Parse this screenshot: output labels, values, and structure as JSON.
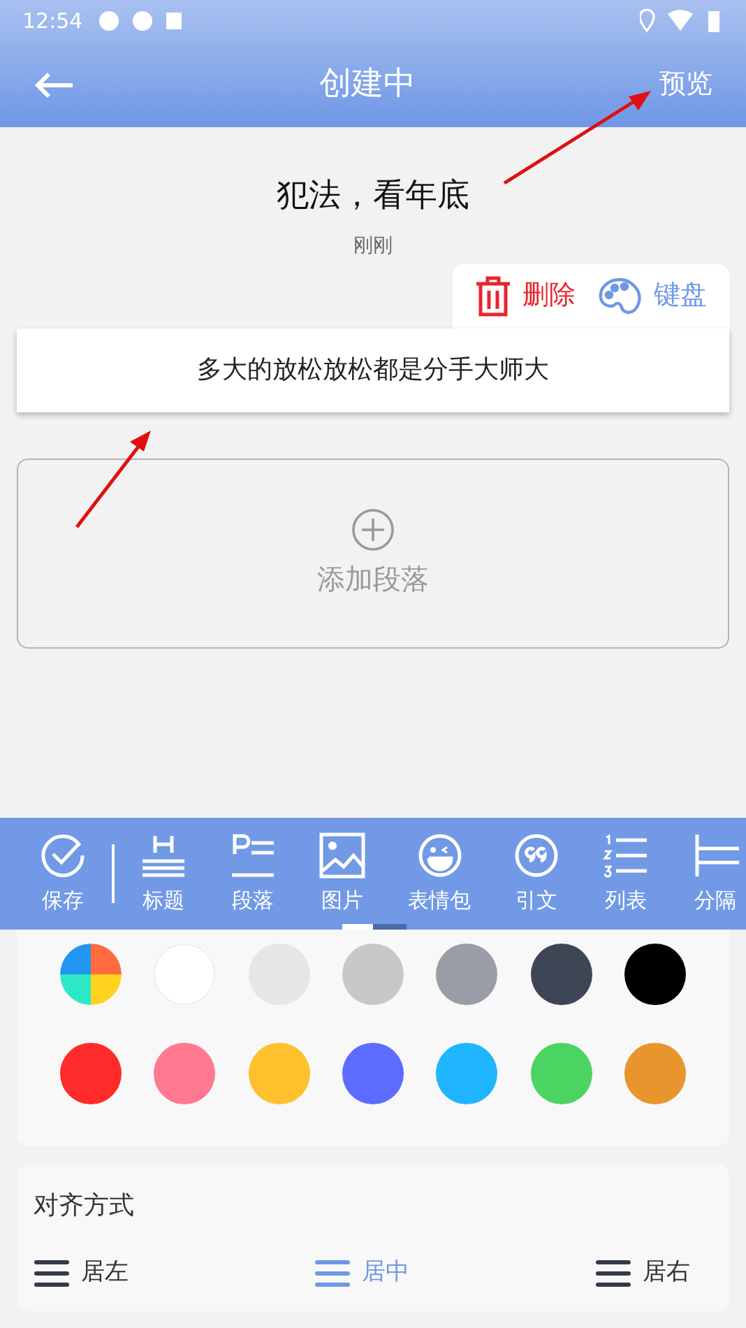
{
  "status_bar": {
    "time": "12:54"
  },
  "app_bar": {
    "title": "创建中",
    "action": "预览"
  },
  "article": {
    "title": "犯法，看年底",
    "time": "刚刚"
  },
  "popover": [
    {
      "kind": "delete",
      "label": "删除"
    },
    {
      "kind": "palette",
      "label": "键盘"
    }
  ],
  "paragraphs": [
    "多大的放松放松都是分手大师大"
  ],
  "add_paragraph": {
    "label": "添加段落"
  },
  "toolbar": [
    {
      "kind": "check",
      "label": "保存"
    },
    {
      "kind": "heading",
      "label": "标题"
    },
    {
      "kind": "paragraph",
      "label": "段落"
    },
    {
      "kind": "image",
      "label": "图片"
    },
    {
      "kind": "emoji",
      "label": "表情包"
    },
    {
      "kind": "quote",
      "label": "引文"
    },
    {
      "kind": "list",
      "label": "列表"
    },
    {
      "kind": "divider",
      "label": "分隔"
    }
  ],
  "colors": [
    {
      "kind": "wheel",
      "color": "#ff6b3d",
      "selected": false
    },
    {
      "kind": "solid",
      "color": "#ffffff",
      "selected": false
    },
    {
      "kind": "solid",
      "color": "#e6e6e6",
      "selected": false
    },
    {
      "kind": "solid",
      "color": "#c8c8c8",
      "selected": false
    },
    {
      "kind": "solid",
      "color": "#9a9ca6",
      "selected": false
    },
    {
      "kind": "solid",
      "color": "#3e4656",
      "selected": false
    },
    {
      "kind": "solid",
      "color": "#000000",
      "selected": false
    },
    {
      "kind": "solid",
      "color": "#ff2a2a",
      "selected": false
    },
    {
      "kind": "solid",
      "color": "#ff7a90",
      "selected": false
    },
    {
      "kind": "solid",
      "color": "#ffc02e",
      "selected": false
    },
    {
      "kind": "solid",
      "color": "#5c6cff",
      "selected": false
    },
    {
      "kind": "solid",
      "color": "#1fb5ff",
      "selected": false
    },
    {
      "kind": "solid",
      "color": "#4cd462",
      "selected": false
    },
    {
      "kind": "solid",
      "color": "#e8952e",
      "selected": false
    }
  ],
  "alignment": {
    "title": "对齐方式",
    "options": [
      {
        "label": "居左",
        "selected": false
      },
      {
        "label": "居中",
        "selected": true
      },
      {
        "label": "居右",
        "selected": false
      }
    ]
  }
}
